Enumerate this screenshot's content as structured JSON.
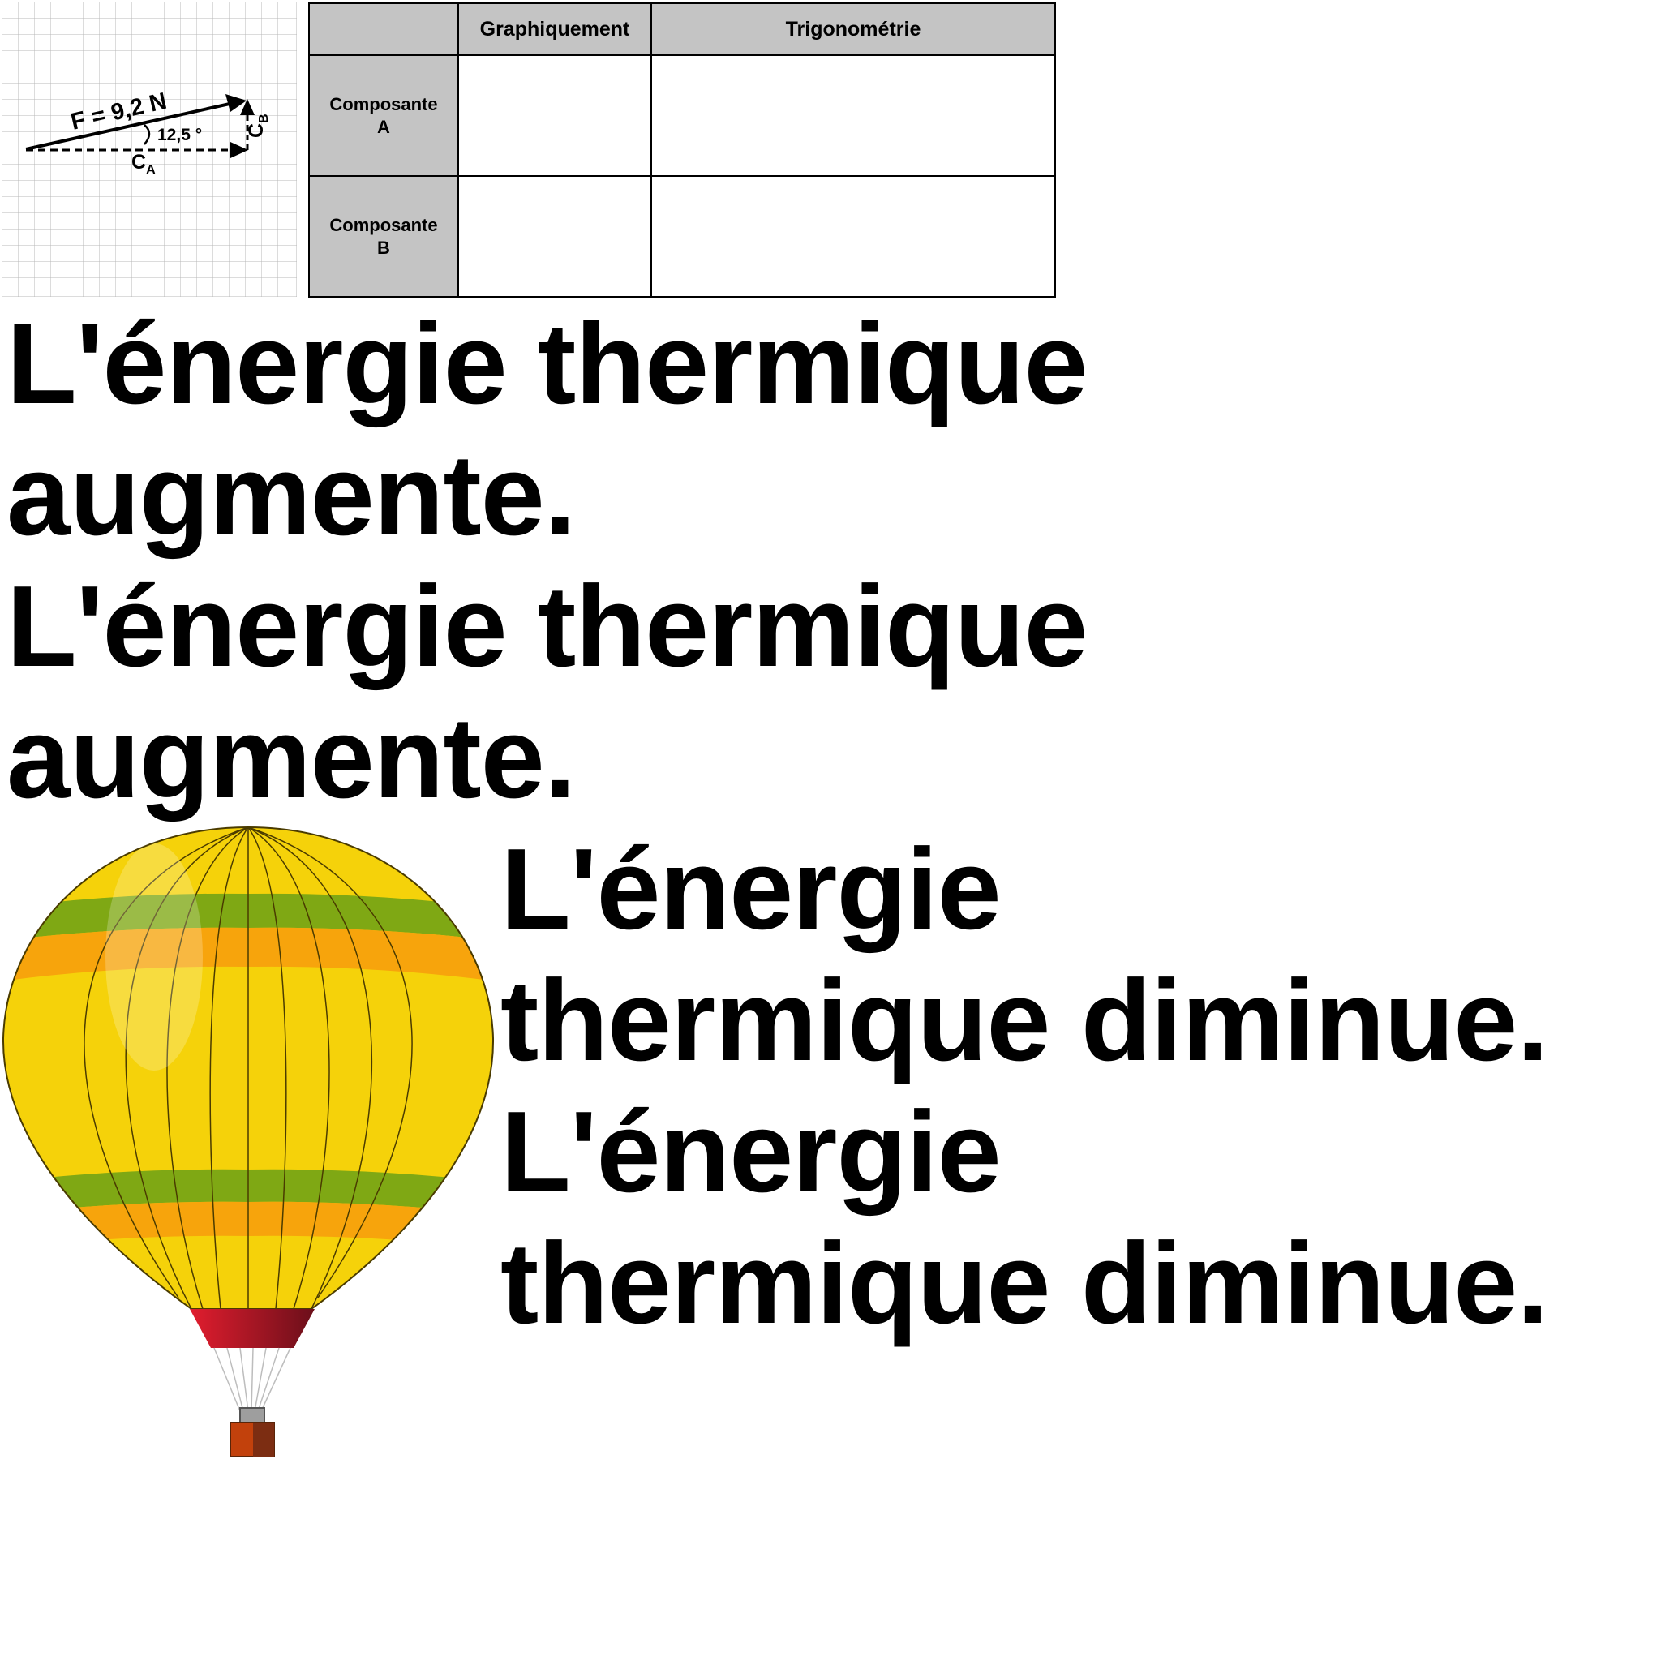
{
  "diagram": {
    "force_label": "F = 9,2 N",
    "angle_label": "12,5 °",
    "component_a_main": "C",
    "component_a_sub": "A",
    "component_b_main": "C",
    "component_b_sub": "B"
  },
  "table": {
    "headers": [
      "",
      "Graphiquement",
      "Trigonométrie"
    ],
    "rows": [
      {
        "label_line1": "Composante",
        "label_line2": "A",
        "cells": [
          "",
          ""
        ]
      },
      {
        "label_line1": "Composante",
        "label_line2": "B",
        "cells": [
          "",
          ""
        ]
      }
    ]
  },
  "statements": {
    "increase_1": {
      "line1": "L'énergie thermique",
      "line2": "augmente."
    },
    "increase_2": {
      "line1": "L'énergie thermique",
      "line2": "augmente."
    },
    "decrease_1": {
      "line1": "L'énergie",
      "line2": "thermique diminue."
    },
    "decrease_2": {
      "line1": "L'énergie",
      "line2": "thermique diminue."
    }
  },
  "balloon": {
    "colors": {
      "yellow": "#f5d20a",
      "green": "#7fa814",
      "orange": "#f7a40c",
      "rim": "#c8102e",
      "basket": "#c2410c"
    }
  }
}
